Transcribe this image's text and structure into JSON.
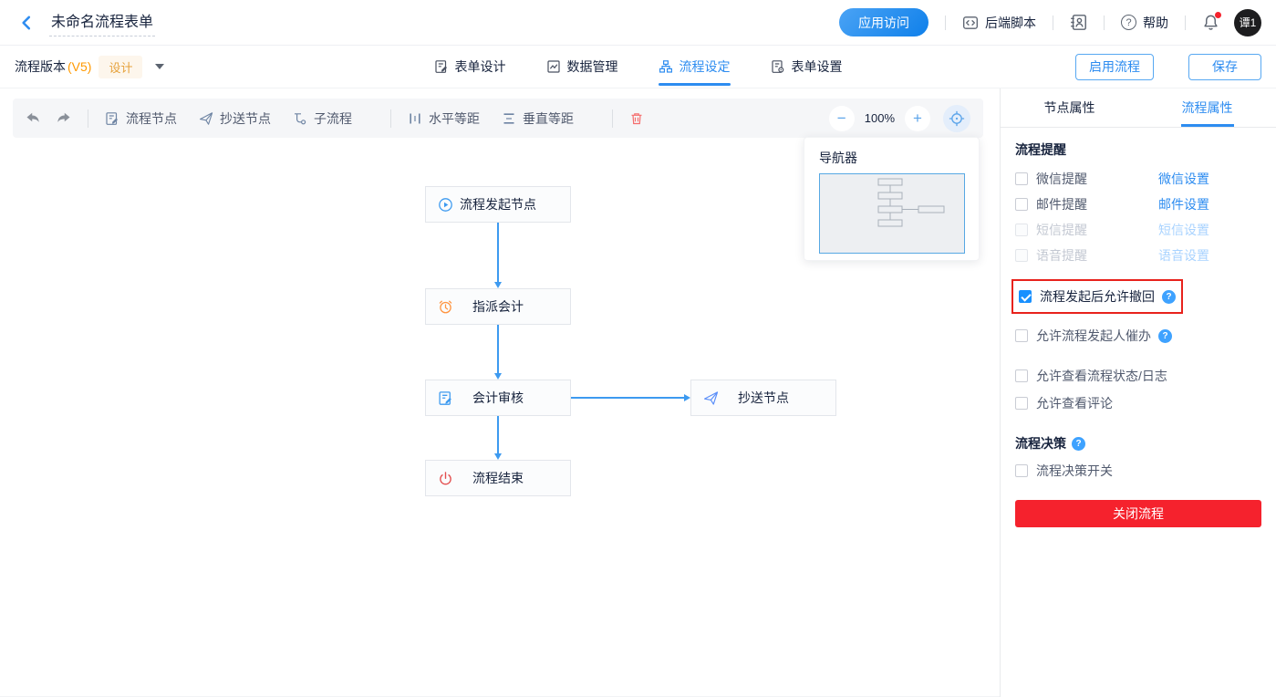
{
  "header": {
    "title": "未命名流程表单",
    "app_access": "应用访问",
    "backend_script": "后端脚本",
    "help": "帮助",
    "avatar": "谭1"
  },
  "version_bar": {
    "version_label": "流程版本",
    "version_value": "(V5)",
    "design_badge": "设计",
    "tabs": [
      {
        "label": "表单设计",
        "active": false
      },
      {
        "label": "数据管理",
        "active": false
      },
      {
        "label": "流程设定",
        "active": true
      },
      {
        "label": "表单设置",
        "active": false
      }
    ],
    "enable_flow": "启用流程",
    "save": "保存"
  },
  "toolbar": {
    "flow_node": "流程节点",
    "cc_node": "抄送节点",
    "sub_flow": "子流程",
    "h_spacing": "水平等距",
    "v_spacing": "垂直等距",
    "zoom_level": "100%"
  },
  "canvas": {
    "navigator_title": "导航器",
    "nodes": [
      {
        "label": "流程发起节点",
        "icon": "play-circle"
      },
      {
        "label": "指派会计",
        "icon": "alarm-clock"
      },
      {
        "label": "会计审核",
        "icon": "doc-edit"
      },
      {
        "label": "抄送节点",
        "icon": "paper-plane"
      },
      {
        "label": "流程结束",
        "icon": "power"
      }
    ]
  },
  "panel": {
    "tab_node": "节点属性",
    "tab_flow": "流程属性",
    "active_tab": "流程属性",
    "reminder_title": "流程提醒",
    "reminders": [
      {
        "label": "微信提醒",
        "link": "微信设置",
        "checked": false,
        "disabled": false
      },
      {
        "label": "邮件提醒",
        "link": "邮件设置",
        "checked": false,
        "disabled": false
      },
      {
        "label": "短信提醒",
        "link": "短信设置",
        "checked": false,
        "disabled": true
      },
      {
        "label": "语音提醒",
        "link": "语音设置",
        "checked": false,
        "disabled": true
      }
    ],
    "allow_withdraw": {
      "label": "流程发起后允许撤回",
      "checked": true,
      "highlighted": true
    },
    "allow_urge": {
      "label": "允许流程发起人催办",
      "checked": false
    },
    "allow_view_status": {
      "label": "允许查看流程状态/日志",
      "checked": false
    },
    "allow_view_comments": {
      "label": "允许查看评论",
      "checked": false
    },
    "decision_title": "流程决策",
    "decision_switch": {
      "label": "流程决策开关",
      "checked": false
    },
    "close_flow": "关闭流程"
  },
  "colors": {
    "primary_blue": "#2d8cf0",
    "arrow_blue": "#3d9af0",
    "danger_red": "#f5222d",
    "highlight_red": "#e8221c",
    "badge_orange": "#e6a23c"
  }
}
